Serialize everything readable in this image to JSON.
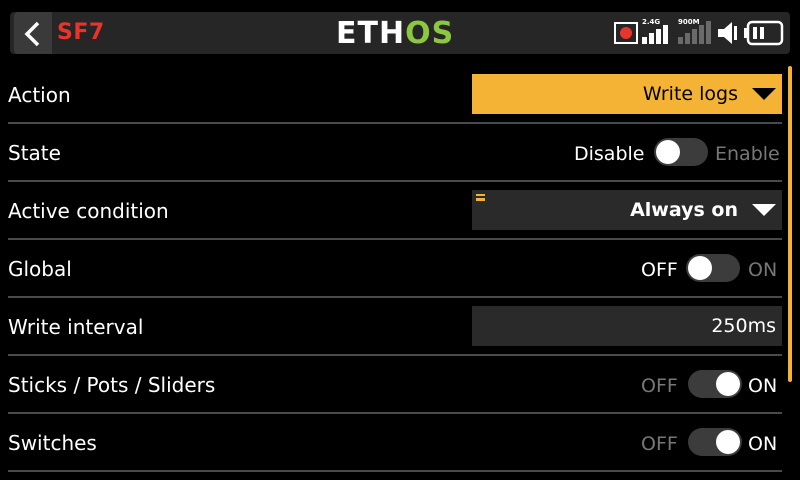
{
  "header": {
    "back_icon": "chevron-left-icon",
    "page_id": "SF7",
    "logo_part1": "ETH",
    "logo_part2": "OS",
    "status": {
      "rec_icon": "record-icon",
      "rf_24": "2.4G",
      "rf_900": "900M",
      "volume_icon": "speaker-icon",
      "battery_icon": "battery-icon"
    },
    "colors": {
      "page_id": "#e8342b",
      "logo_accent": "#8dc63f",
      "accent": "#f5b335"
    }
  },
  "rows": [
    {
      "label": "Action",
      "value": "Write logs"
    },
    {
      "label": "State",
      "off_text": "Disable",
      "on_text": "Enable",
      "enabled": false
    },
    {
      "label": "Active condition",
      "value": "Always on"
    },
    {
      "label": "Global",
      "off_text": "OFF",
      "on_text": "ON",
      "enabled": false
    },
    {
      "label": "Write interval",
      "value": "250ms"
    },
    {
      "label": "Sticks / Pots / Sliders",
      "off_text": "OFF",
      "on_text": "ON",
      "enabled": true
    },
    {
      "label": "Switches",
      "off_text": "OFF",
      "on_text": "ON",
      "enabled": true
    }
  ]
}
